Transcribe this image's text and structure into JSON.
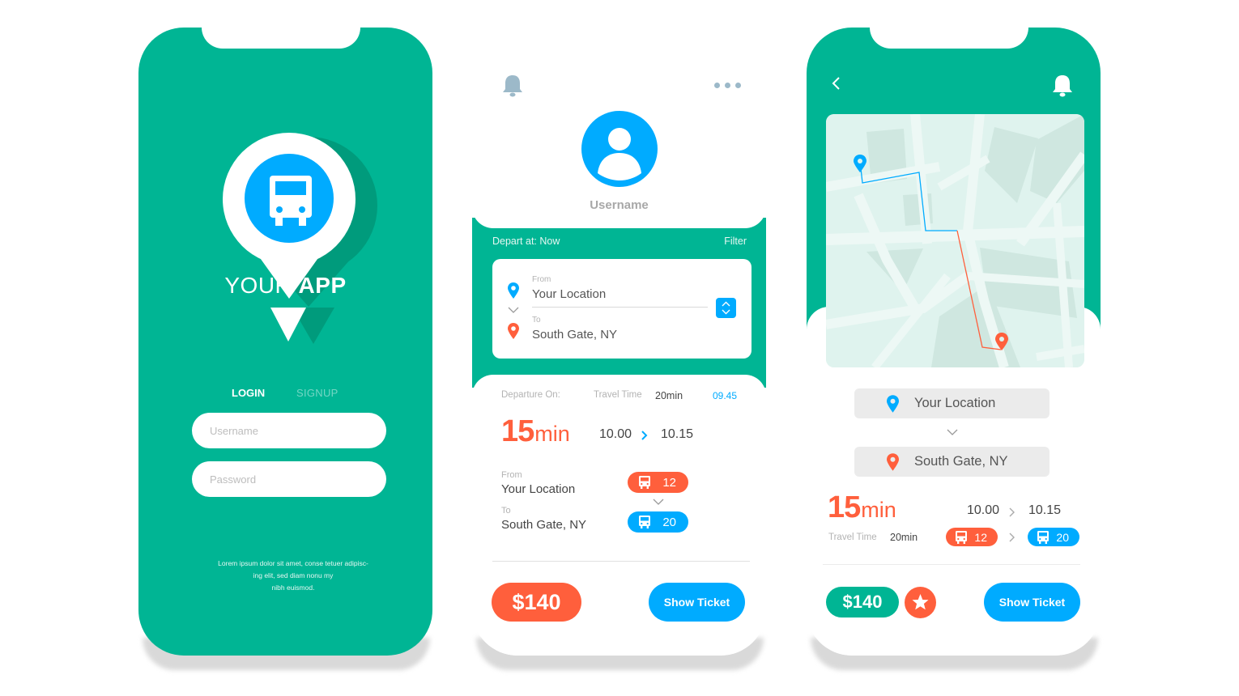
{
  "colors": {
    "teal": "#00b594",
    "teal_dark": "#009b7c",
    "blue": "#00abff",
    "orange": "#ff5f3c",
    "grey_text": "#b3b3b3"
  },
  "login_screen": {
    "logo_icon": "bus-icon",
    "app_title_light": "YOUR ",
    "app_title_bold": "APP",
    "tabs": [
      {
        "label": "LOGIN",
        "active": true
      },
      {
        "label": "SIGNUP",
        "active": false
      }
    ],
    "username_placeholder": "Username",
    "password_placeholder": "Password",
    "footer_lines": [
      "Lorem ipsum dolor sit amet, conse tetuer adipisc-",
      "ing elit, sed diam nonu my",
      "nibh euismod."
    ]
  },
  "profile_screen": {
    "bell_icon": "bell-icon",
    "more_icon": "more-dots-icon",
    "username": "Username",
    "depart_at": "Depart at: Now",
    "filter": "Filter",
    "route": {
      "from_label": "From",
      "from_value": "Your Location",
      "to_label": "To",
      "to_value": "South Gate, NY"
    },
    "trip": {
      "departure_on_label": "Departure On:",
      "travel_time_label": "Travel Time",
      "travel_time_value": "20min",
      "departure_time": "09.45",
      "duration_number": "15",
      "duration_unit": "min",
      "time_start": "10.00",
      "time_end": "10.15",
      "from_label": "From",
      "from_value": "Your Location",
      "to_label": "To",
      "to_value": "South Gate, NY",
      "bus_first": "12",
      "bus_second": "20"
    },
    "price": "$140",
    "show_ticket": "Show Ticket"
  },
  "map_screen": {
    "back_icon": "chevron-left-icon",
    "bell_icon": "bell-icon",
    "from_value": "Your Location",
    "to_value": "South Gate, NY",
    "duration_number": "15",
    "duration_unit": "min",
    "time_start": "10.00",
    "time_end": "10.15",
    "travel_time_label": "Travel Time",
    "travel_time_value": "20min",
    "bus_first": "12",
    "bus_second": "20",
    "price": "$140",
    "favorite_icon": "star-icon",
    "show_ticket": "Show Ticket"
  }
}
